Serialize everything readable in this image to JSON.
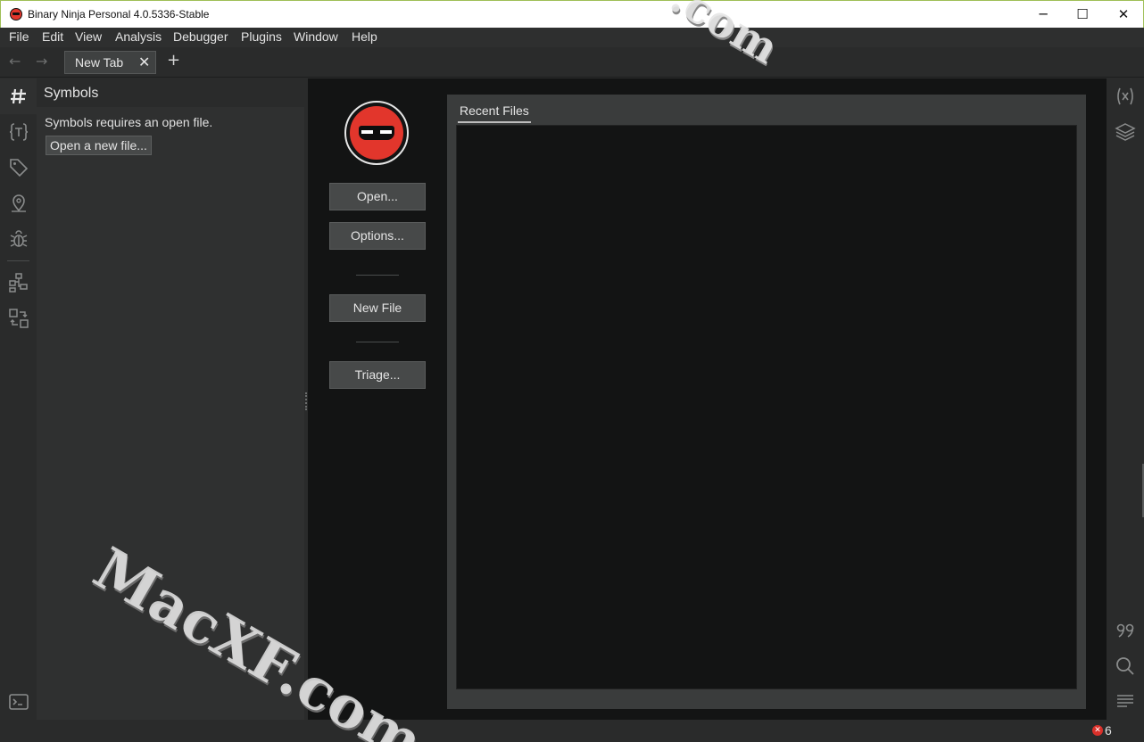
{
  "window": {
    "title": "Binary Ninja Personal 4.0.5336-Stable",
    "minimize_glyph": "─",
    "maximize_glyph": "☐",
    "close_glyph": "✕"
  },
  "menu": [
    "File",
    "Edit",
    "View",
    "Analysis",
    "Debugger",
    "Plugins",
    "Window",
    "Help"
  ],
  "tabbar": {
    "back_glyph": "←",
    "forward_glyph": "→",
    "tab_label": "New Tab",
    "tab_close_glyph": "✕",
    "add_glyph": "+"
  },
  "left_rail_icons": [
    "symbols-hash-icon",
    "types-icon",
    "tags-icon",
    "location-pin-icon",
    "debugger-bug-icon",
    "hierarchy-icon",
    "cross-references-icon",
    "terminal-icon"
  ],
  "symbols": {
    "title": "Symbols",
    "message": "Symbols requires an open file.",
    "open_button": "Open a new file..."
  },
  "main": {
    "open_button": "Open...",
    "options_button": "Options...",
    "new_file_button": "New File",
    "triage_button": "Triage...",
    "recent_files_tab": "Recent Files"
  },
  "right_rail_icons": [
    "variables-icon",
    "layers-icon",
    "quote-icon",
    "search-icon",
    "text-lines-icon"
  ],
  "status": {
    "error_glyph": "✕",
    "error_count": "6"
  },
  "watermark": {
    "text": "MacXF.com",
    "top_fragment": ".com"
  },
  "colors": {
    "accent_red": "#e2362c",
    "panel_bg": "#2f3030",
    "main_bg": "#131414",
    "button_bg": "#474949"
  }
}
